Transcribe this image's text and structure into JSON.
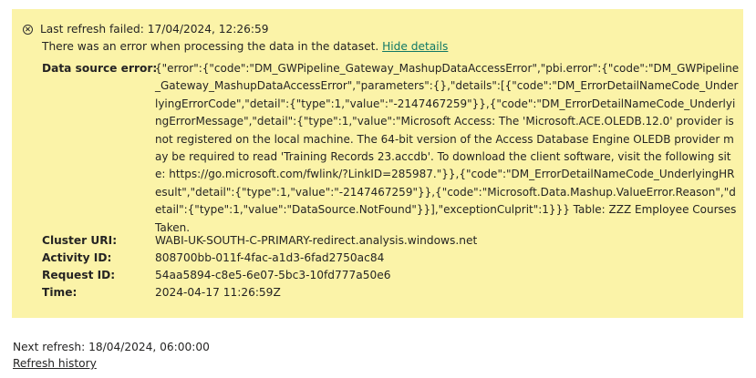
{
  "alert": {
    "title": "Last refresh failed: 17/04/2024, 12:26:59",
    "message": "There was an error when processing the data in the dataset.",
    "hide_details_link": "Hide details",
    "details": {
      "data_source_error_label": "Data source error:",
      "data_source_error_value": "{\"error\":{\"code\":\"DM_GWPipeline_Gateway_MashupDataAccessError\",\"pbi.error\":{\"code\":\"DM_GWPipeline_Gateway_MashupDataAccessError\",\"parameters\":{},\"details\":[{\"code\":\"DM_ErrorDetailNameCode_UnderlyingErrorCode\",\"detail\":{\"type\":1,\"value\":\"-2147467259\"}},{\"code\":\"DM_ErrorDetailNameCode_UnderlyingErrorMessage\",\"detail\":{\"type\":1,\"value\":\"Microsoft Access: The 'Microsoft.ACE.OLEDB.12.0' provider is not registered on the local machine. The 64-bit version of the Access Database Engine OLEDB provider may be required to read 'Training Records 23.accdb'. To download the client software, visit the following site: https://go.microsoft.com/fwlink/?LinkID=285987.\"}},{\"code\":\"DM_ErrorDetailNameCode_UnderlyingHResult\",\"detail\":{\"type\":1,\"value\":\"-2147467259\"}},{\"code\":\"Microsoft.Data.Mashup.ValueError.Reason\",\"detail\":{\"type\":1,\"value\":\"DataSource.NotFound\"}}],\"exceptionCulprit\":1}}} Table: ZZZ Employee Courses Taken.",
      "cluster_uri_label": "Cluster URI:",
      "cluster_uri_value": "WABI-UK-SOUTH-C-PRIMARY-redirect.analysis.windows.net",
      "activity_id_label": "Activity ID:",
      "activity_id_value": "808700bb-011f-4fac-a1d3-6fad2750ac84",
      "request_id_label": "Request ID:",
      "request_id_value": "54aa5894-c8e5-6e07-5bc3-10fd777a50e6",
      "time_label": "Time:",
      "time_value": "2024-04-17 11:26:59Z"
    }
  },
  "footer": {
    "next_refresh": "Next refresh: 18/04/2024, 06:00:00",
    "refresh_history_link": "Refresh history"
  },
  "colors": {
    "alert_background": "#fbf3a8",
    "link": "#117865",
    "text": "#252423"
  }
}
